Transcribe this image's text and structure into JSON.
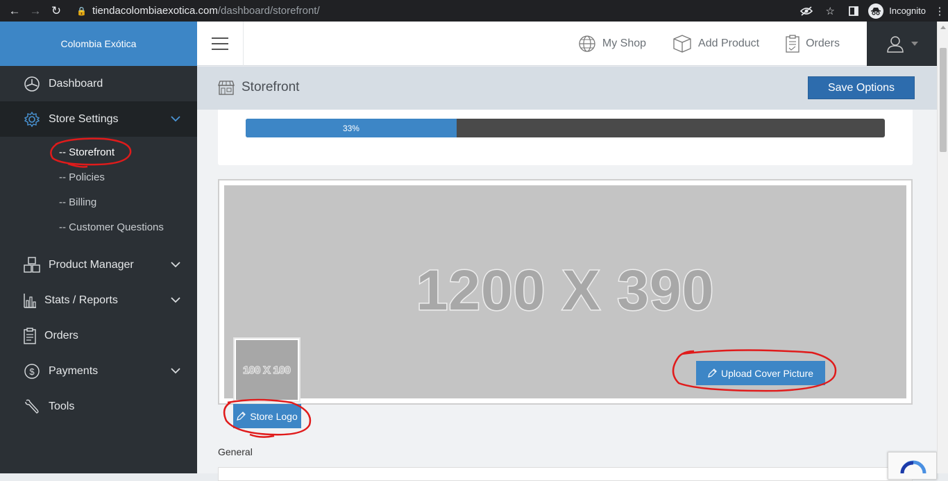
{
  "browser": {
    "url_host": "tiendacolombiaexotica.com",
    "url_path": "/dashboard/storefront/",
    "incognito_label": "Incognito"
  },
  "sidebar": {
    "brand": "Colombia Exótica",
    "items": [
      {
        "label": "Dashboard",
        "icon": "dashboard-icon"
      },
      {
        "label": "Store Settings",
        "icon": "gear-icon",
        "expanded": true
      },
      {
        "label": "Product Manager",
        "icon": "boxes-icon"
      },
      {
        "label": "Stats / Reports",
        "icon": "bar-chart-icon"
      },
      {
        "label": "Orders",
        "icon": "clipboard-icon"
      },
      {
        "label": "Payments",
        "icon": "dollar-icon"
      },
      {
        "label": "Tools",
        "icon": "wrench-icon"
      }
    ],
    "store_settings_sub": [
      "-- Storefront",
      "-- Policies",
      "-- Billing",
      "-- Customer Questions"
    ]
  },
  "topbar": {
    "links": [
      {
        "label": "My Shop",
        "icon": "globe-icon"
      },
      {
        "label": "Add Product",
        "icon": "box-icon"
      },
      {
        "label": "Orders",
        "icon": "clipboard-icon"
      }
    ]
  },
  "page": {
    "title": "Storefront",
    "save_label": "Save Options",
    "progress_label": "33%",
    "progress_value": 0.33,
    "cover_placeholder": "1200 X 390",
    "logo_placeholder": "100 X 100",
    "logo_button": "Store Logo",
    "cover_button": "Upload Cover Picture",
    "general_label": "General"
  },
  "colors": {
    "brand_blue": "#3d86c6",
    "sidebar_dark": "#2b3035",
    "button_dark_blue": "#2d6cad",
    "annotation_red": "#e01b1b"
  }
}
